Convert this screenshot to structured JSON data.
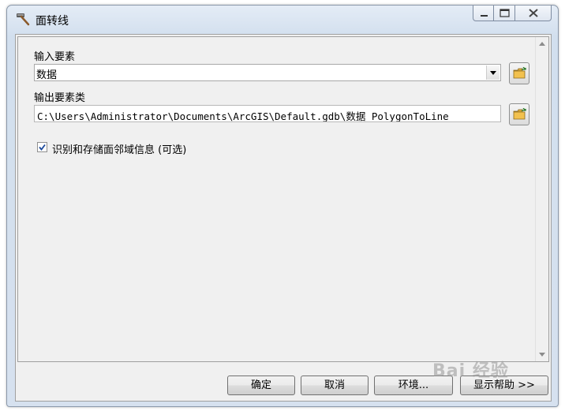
{
  "window": {
    "title": "面转线",
    "controls": [
      "minimize-icon",
      "maximize-icon",
      "close-icon"
    ]
  },
  "form": {
    "input_label": "输入要素",
    "input_value": "数据",
    "output_label": "输出要素类",
    "output_value": "C:\\Users\\Administrator\\Documents\\ArcGIS\\Default.gdb\\数据_PolygonToLine",
    "checkbox_label": "识别和存储面邻域信息 (可选)",
    "checkbox_checked": true
  },
  "buttons": {
    "ok": "确定",
    "cancel": "取消",
    "environments": "环境...",
    "help": "显示帮助 >>"
  },
  "watermark": "Bai 经验",
  "colors": {
    "folder_yellow": "#f2c14e",
    "check_blue": "#1c4a9c"
  }
}
